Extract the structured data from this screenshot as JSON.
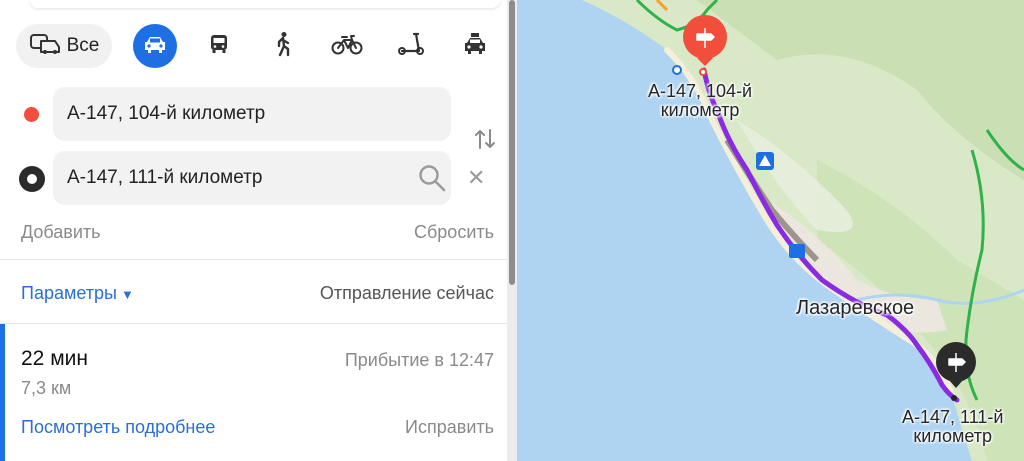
{
  "transport_modes": {
    "all_label": "Все",
    "items": [
      "car",
      "public-transport",
      "pedestrian",
      "bicycle",
      "scooter",
      "taxi"
    ],
    "selected": "car"
  },
  "route_form": {
    "from_value": "А-147, 104-й километр",
    "to_value": "А-147, 111-й километр",
    "add_label": "Добавить",
    "reset_label": "Сбросить"
  },
  "options": {
    "params_label": "Параметры",
    "departure_label": "Отправление сейчас"
  },
  "route": {
    "time": "22 мин",
    "arrival": "Прибытие в 12:47",
    "distance": "7,3 км",
    "details_label": "Посмотреть подробнее",
    "fix_label": "Исправить"
  },
  "map": {
    "start_label_line1": "А-147, 104-й",
    "start_label_line2": "километр",
    "end_label_line1": "А-147, 111-й",
    "end_label_line2": "километр",
    "town_label": "Лазаревское"
  },
  "colors": {
    "accent": "#1e6fe4",
    "route": "#8a2be2",
    "sea": "#aed4f2",
    "land": "#d7e9c4",
    "start_pin": "#f14e3c",
    "end_pin": "#2b2b2b"
  }
}
